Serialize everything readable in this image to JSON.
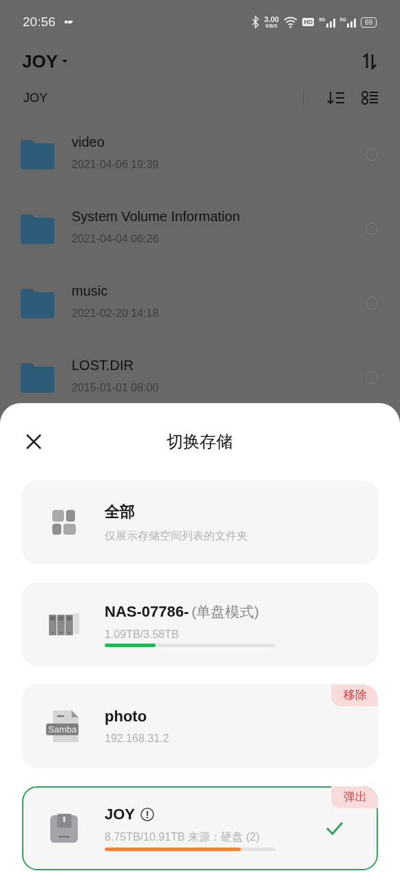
{
  "status_bar": {
    "time": "20:56",
    "speed_value": "3.00",
    "speed_unit": "KB/S",
    "hd_label": "HD",
    "signals": [
      {
        "label": "5G"
      },
      {
        "label": "5G"
      }
    ],
    "battery": "69"
  },
  "header": {
    "title": "JOY",
    "breadcrumb": "JOY"
  },
  "files": [
    {
      "name": "video",
      "date": "2021-04-06 19:39",
      "selected": false
    },
    {
      "name": "System Volume Information",
      "date": "2021-04-04 06:26",
      "selected": false
    },
    {
      "name": "music",
      "date": "2021-02-20 14:18",
      "selected": false
    },
    {
      "name": "LOST.DIR",
      "date": "2015-01-01 08:00",
      "selected": false
    }
  ],
  "sheet": {
    "title": "切换存储",
    "items": [
      {
        "kind": "all",
        "title": "全部",
        "subtitle": "仅展示存储空间列表的文件夹",
        "selected": false
      },
      {
        "kind": "nas",
        "title": "NAS-07786-",
        "title_suffix": "(单盘模式)",
        "subtitle": "1.09TB/3.58TB",
        "level": 0.3,
        "color": "#1db954",
        "selected": false
      },
      {
        "kind": "samba",
        "icon_label": "Samba",
        "title": "photo",
        "subtitle": "192.168.31.2",
        "badge": "移除",
        "selected": false
      },
      {
        "kind": "disk",
        "title": "JOY",
        "warning": true,
        "subtitle": "8.75TB/10.91TB 来源：硬盘 (2)",
        "level": 0.8,
        "color": "#f0843a",
        "badge": "弹出",
        "selected": true
      }
    ]
  }
}
